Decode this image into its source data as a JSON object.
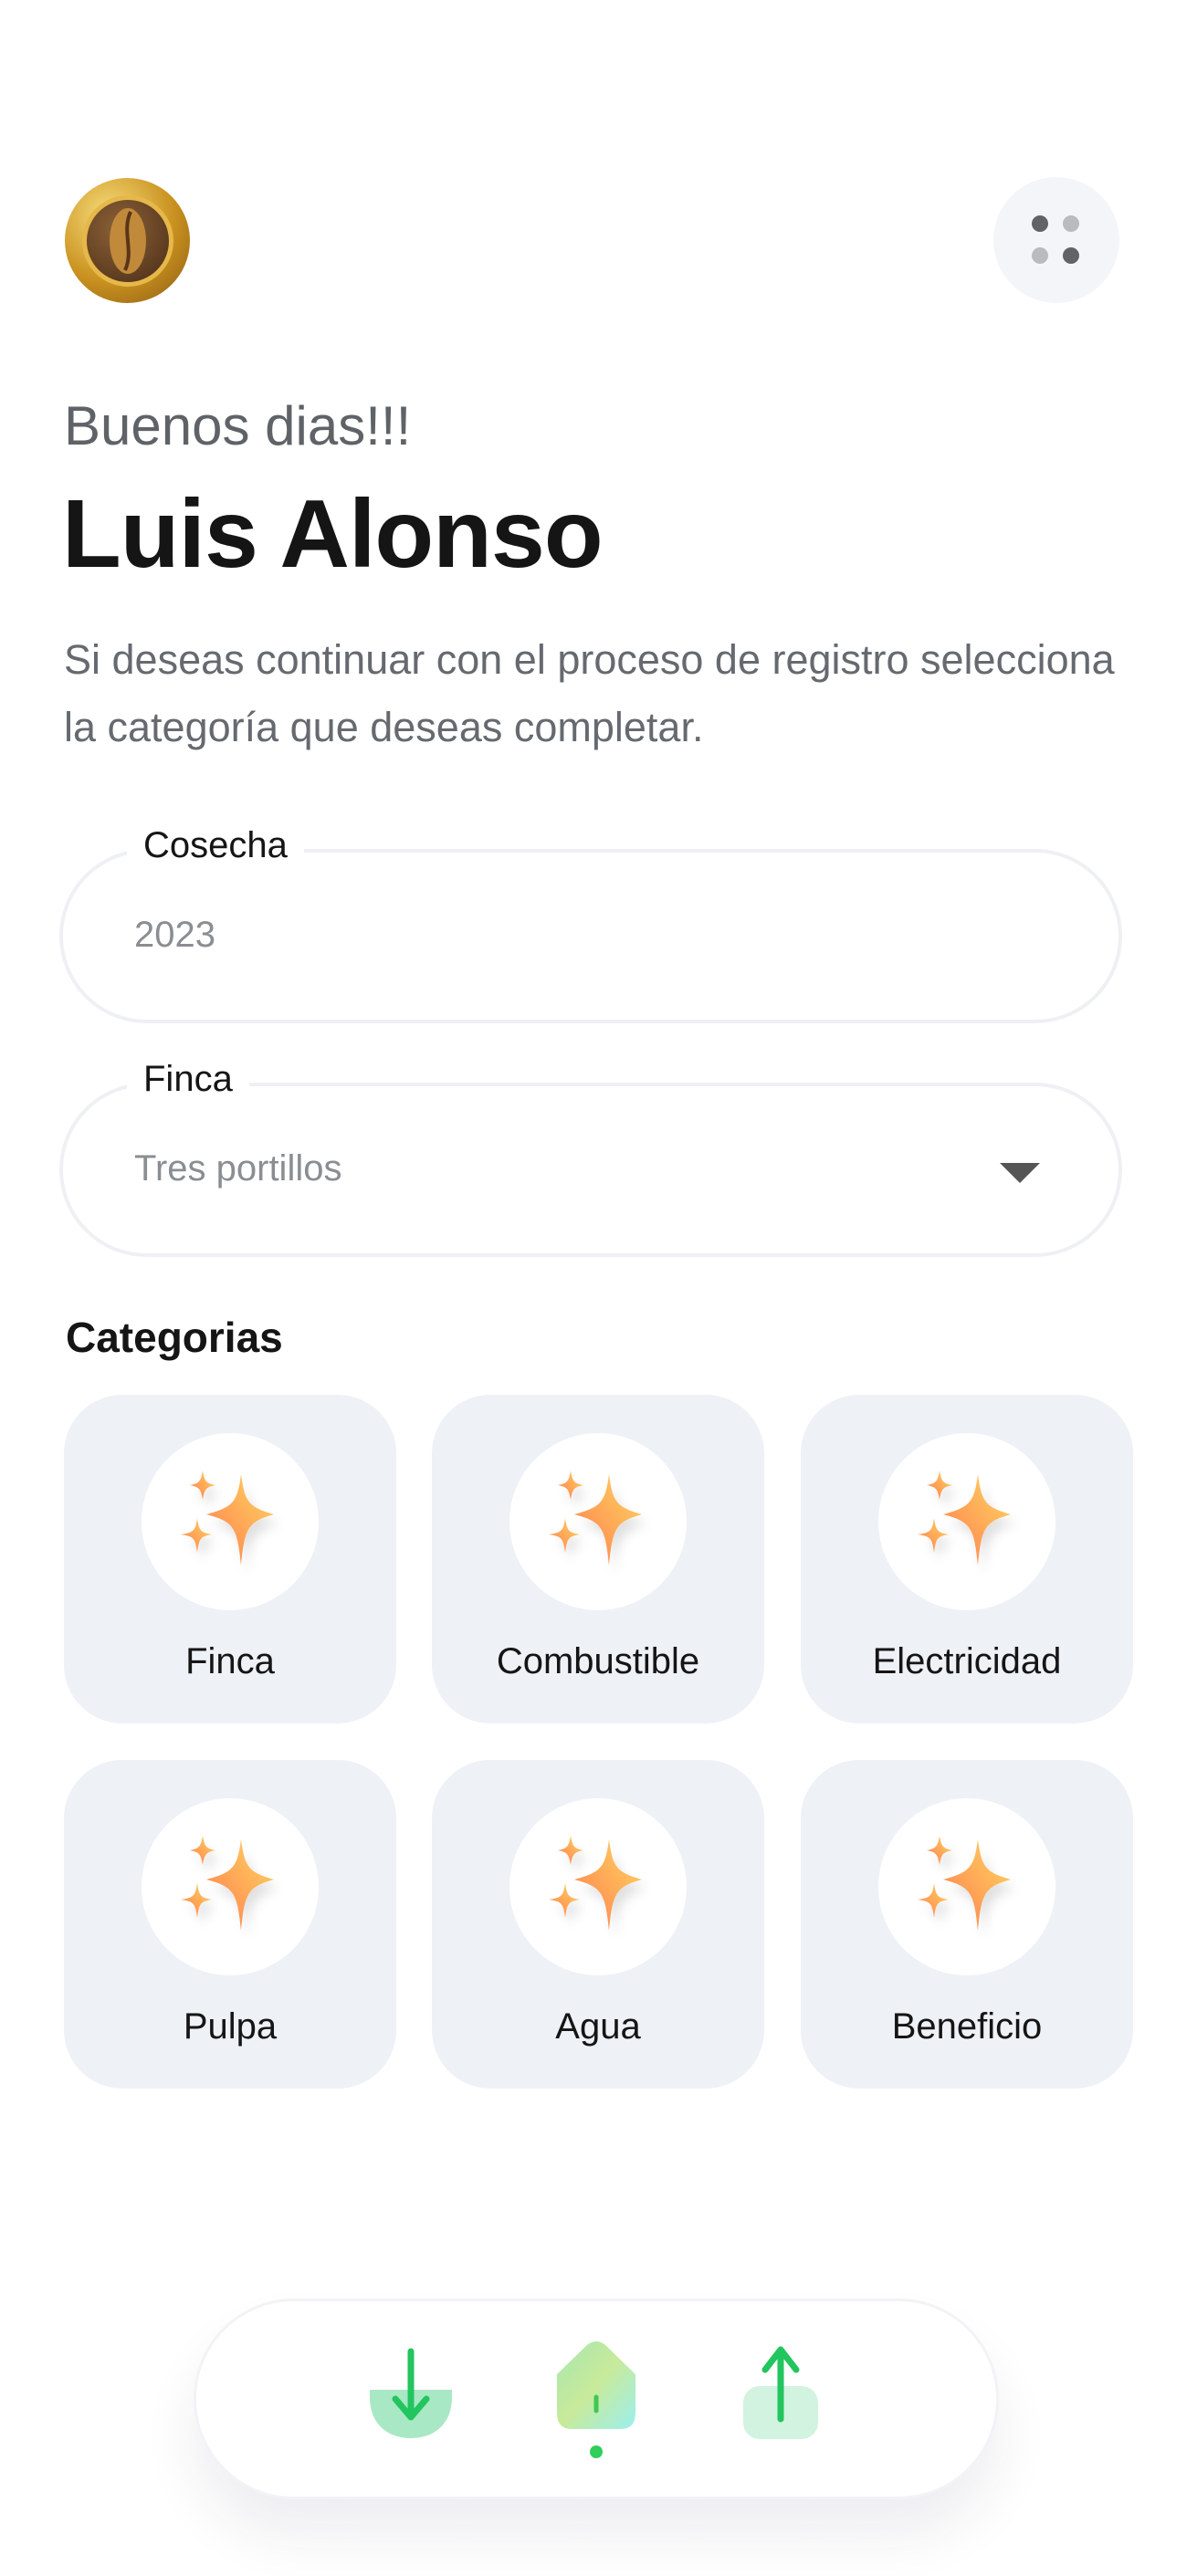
{
  "header": {
    "logo_icon": "coffee-bean-coin-logo",
    "menu_icon": "dots-grid-icon"
  },
  "greeting": "Buenos dias!!!",
  "user_name": "Luis Alonso",
  "intro": "Si deseas continuar con el proceso de registro selecciona la categoría que deseas completar.",
  "form": {
    "cosecha": {
      "label": "Cosecha",
      "value": "2023"
    },
    "finca": {
      "label": "Finca",
      "value": "Tres portillos"
    }
  },
  "categories_title": "Categorias",
  "categories": [
    {
      "label": "Finca",
      "icon": "sparkles-icon"
    },
    {
      "label": "Combustible",
      "icon": "sparkles-icon"
    },
    {
      "label": "Electricidad",
      "icon": "sparkles-icon"
    },
    {
      "label": "Pulpa",
      "icon": "sparkles-icon"
    },
    {
      "label": "Agua",
      "icon": "sparkles-icon"
    },
    {
      "label": "Beneficio",
      "icon": "sparkles-icon"
    }
  ],
  "bottom_nav": {
    "items": [
      {
        "icon": "download-icon"
      },
      {
        "icon": "home-icon",
        "active": true
      },
      {
        "icon": "upload-icon"
      }
    ]
  },
  "colors": {
    "accent_green": "#22c55e",
    "card_bg": "#eef1f6",
    "sparkle_orange": "#ff9a50"
  }
}
